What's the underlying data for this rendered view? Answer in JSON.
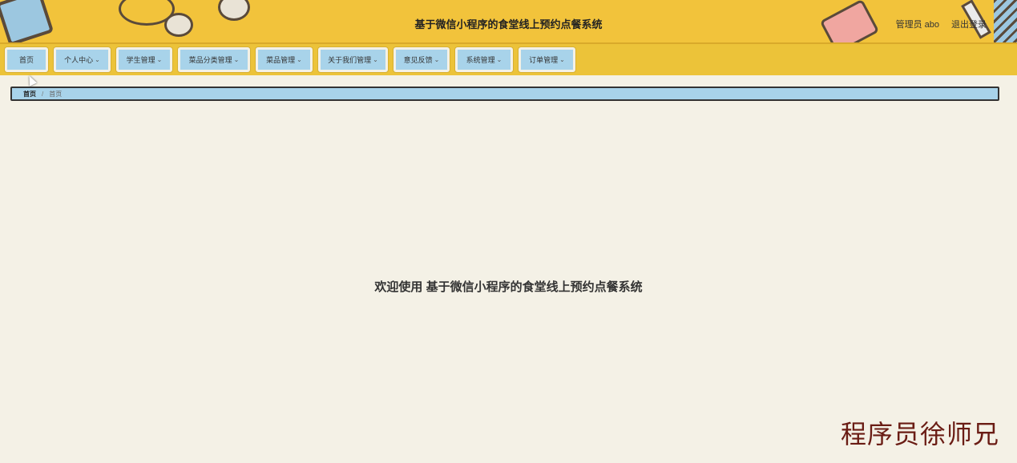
{
  "header": {
    "title": "基于微信小程序的食堂线上预约点餐系统",
    "user": "管理员 abo",
    "logout": "退出登录"
  },
  "nav": [
    {
      "label": "首页",
      "dropdown": false
    },
    {
      "label": "个人中心",
      "dropdown": true
    },
    {
      "label": "学生管理",
      "dropdown": true
    },
    {
      "label": "菜品分类管理",
      "dropdown": true
    },
    {
      "label": "菜品管理",
      "dropdown": true
    },
    {
      "label": "关于我们管理",
      "dropdown": true
    },
    {
      "label": "意见反馈",
      "dropdown": true
    },
    {
      "label": "系统管理",
      "dropdown": true
    },
    {
      "label": "订单管理",
      "dropdown": true
    }
  ],
  "breadcrumb": {
    "home": "首页",
    "separator": "/",
    "current": "首页"
  },
  "welcome": "欢迎使用 基于微信小程序的食堂线上预约点餐系统",
  "watermark": "程序员徐师兄",
  "icons": {
    "dropdown": "chevron-down-icon"
  },
  "colors": {
    "header": "#f2c33b",
    "nav_item": "#a8d3ea",
    "background": "#f4f1e6",
    "watermark": "#6a1c14"
  }
}
